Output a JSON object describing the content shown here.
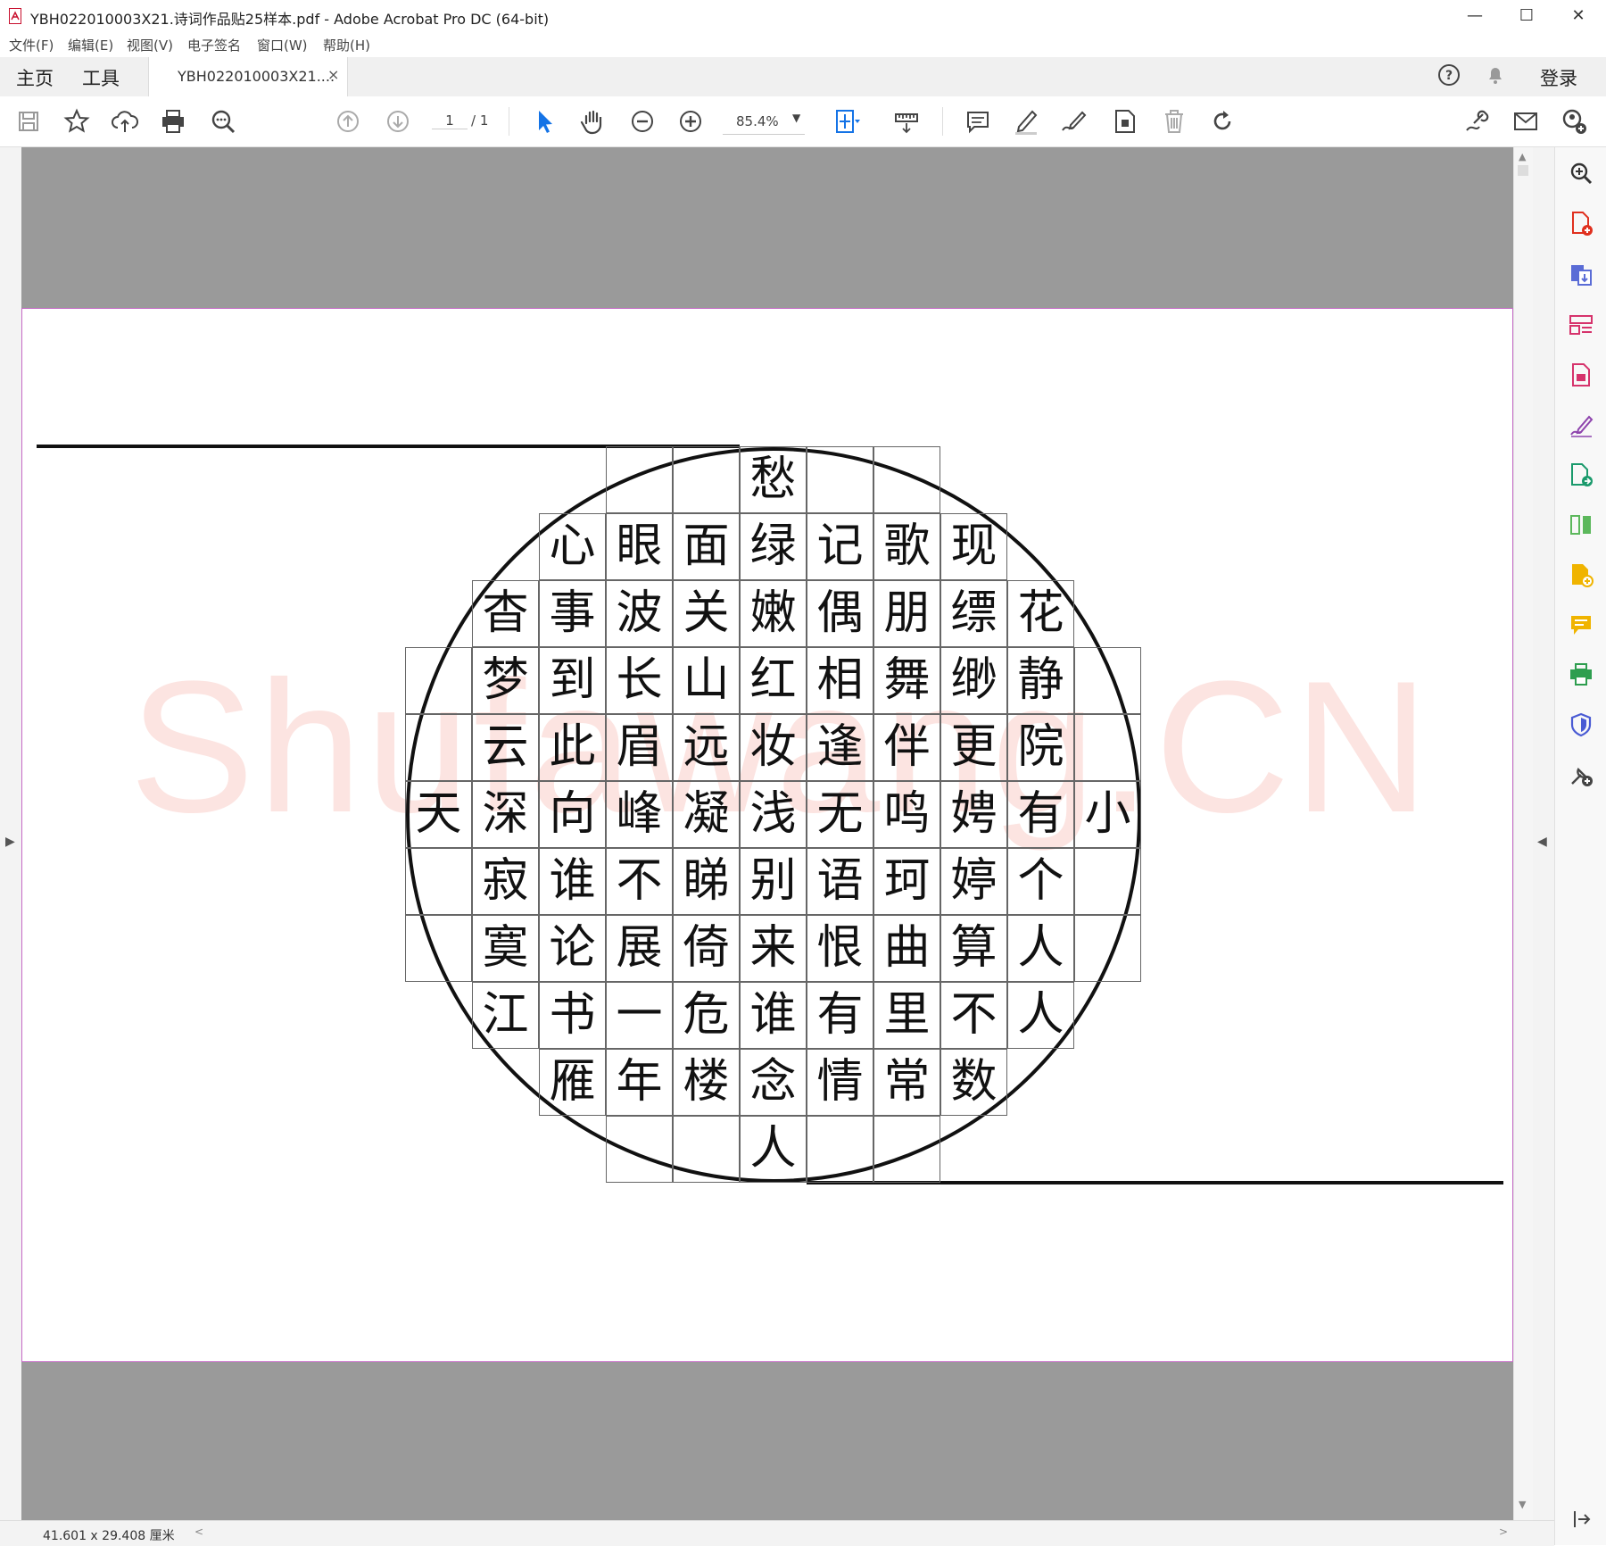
{
  "window": {
    "title": "YBH022010003X21.诗词作品贴25样本.pdf - Adobe Acrobat Pro DC (64-bit)",
    "controls": {
      "minimize": "—",
      "maximize": "☐",
      "close": "✕"
    }
  },
  "menu": [
    "文件(F)",
    "编辑(E)",
    "视图(V)",
    "电子签名",
    "窗口(W)",
    "帮助(H)"
  ],
  "tabs": {
    "home": "主页",
    "tools": "工具",
    "document": "YBH022010003X21....",
    "close": "×",
    "signin": "登录"
  },
  "toolbar": {
    "page_current": "1",
    "page_total": "/ 1",
    "zoom": "85.4%",
    "zoom_caret": "▼"
  },
  "status": {
    "dimensions": "41.601 x 29.408 厘米",
    "left_arrow": "<",
    "right_arrow": ">"
  },
  "side_arrows": {
    "left": "▶",
    "right": "◀",
    "up": "▲",
    "down": "▼"
  },
  "watermark": "Shufawang.CN",
  "colors": {
    "page_border": "#c56ac6",
    "canvas_gray": "#9a9a9a",
    "select_tool_blue": "#1473e6",
    "watermark": "#eb5a46"
  },
  "grid": {
    "rows": [
      [
        "",
        "",
        "",
        "",
        "",
        "愁",
        "",
        "",
        "",
        "",
        ""
      ],
      [
        "",
        "",
        "心",
        "眼",
        "面",
        "绿",
        "记",
        "歌",
        "现",
        "",
        ""
      ],
      [
        "",
        "杳",
        "事",
        "波",
        "关",
        "嫩",
        "偶",
        "朋",
        "缥",
        "花",
        ""
      ],
      [
        "",
        "梦",
        "到",
        "长",
        "山",
        "红",
        "相",
        "舞",
        "缈",
        "静",
        ""
      ],
      [
        "",
        "云",
        "此",
        "眉",
        "远",
        "妆",
        "逢",
        "伴",
        "更",
        "院",
        ""
      ],
      [
        "天",
        "深",
        "向",
        "峰",
        "凝",
        "浅",
        "无",
        "鸣",
        "娉",
        "有",
        "小"
      ],
      [
        "",
        "寂",
        "谁",
        "不",
        "睇",
        "别",
        "语",
        "珂",
        "婷",
        "个",
        ""
      ],
      [
        "",
        "寞",
        "论",
        "展",
        "倚",
        "来",
        "恨",
        "曲",
        "算",
        "人",
        ""
      ],
      [
        "",
        "江",
        "书",
        "一",
        "危",
        "谁",
        "有",
        "里",
        "不",
        "人",
        ""
      ],
      [
        "",
        "",
        "雁",
        "年",
        "楼",
        "念",
        "情",
        "常",
        "数",
        "",
        ""
      ],
      [
        "",
        "",
        "",
        "",
        "",
        "人",
        "",
        "",
        "",
        "",
        ""
      ]
    ]
  },
  "icons": {
    "toolbar": [
      "save-icon",
      "bookmark-star-icon",
      "cloud-upload-icon",
      "print-icon",
      "search-zoom-icon",
      "page-up-icon",
      "page-down-icon",
      "select-arrow-icon",
      "hand-icon",
      "zoom-out-icon",
      "zoom-in-icon",
      "fit-page-icon",
      "measure-icon",
      "comment-icon",
      "highlight-pen-icon",
      "draw-sign-icon",
      "stamp-icon",
      "delete-icon",
      "rotate-icon",
      "share-link-icon",
      "email-icon",
      "add-user-icon"
    ],
    "right_panel": [
      "zoom-search-icon",
      "create-pdf-icon",
      "export-pdf-icon",
      "organize-pages-icon",
      "edit-pdf-icon",
      "fill-sign-icon",
      "send-for-sign-icon",
      "compare-icon",
      "scan-icon",
      "comment-icon",
      "print-production-icon",
      "protect-icon",
      "more-tools-icon"
    ]
  }
}
